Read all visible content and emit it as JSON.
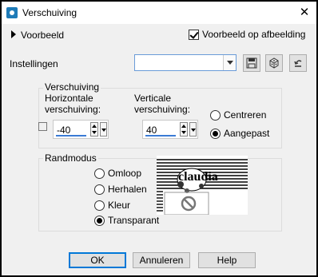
{
  "window": {
    "title": "Verschuiving",
    "close_glyph": "✕"
  },
  "preview_toggle": {
    "label": "Voorbeeld"
  },
  "preview_on_image": {
    "label": "Voorbeeld op afbeelding",
    "checked": true
  },
  "settings": {
    "label": "Instellingen",
    "value": ""
  },
  "toolbar_icons": [
    "save-icon",
    "randomize-dice-icon",
    "reset-icon"
  ],
  "offset_group": {
    "title": "Verschuiving",
    "horizontal_label": "Horizontale verschuiving:",
    "vertical_label": "Verticale verschuiving:",
    "horizontal_value": "-40",
    "vertical_value": "40",
    "center_label": "Centreren",
    "custom_label": "Aangepast",
    "selected": "Aangepast"
  },
  "edge_group": {
    "title": "Randmodus",
    "options": [
      "Omloop",
      "Herhalen",
      "Kleur",
      "Transparant"
    ],
    "selected": "Transparant",
    "preview_watermark": "claudia"
  },
  "buttons": {
    "ok": "OK",
    "cancel": "Annuleren",
    "help": "Help"
  },
  "colors": {
    "accent": "#0078d7",
    "dialog_bg": "#f0f0f0",
    "border": "#000000"
  }
}
